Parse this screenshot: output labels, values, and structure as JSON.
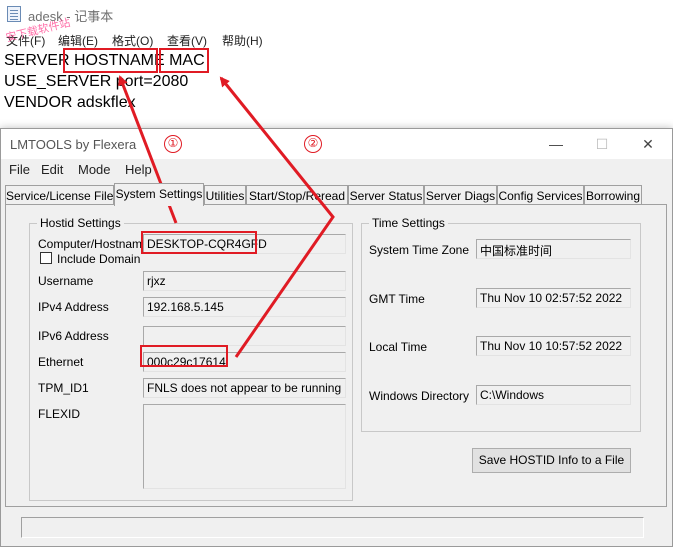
{
  "notepad": {
    "title": "adesk - 记事本",
    "watermark": "安下载软件站",
    "menu": [
      "文件(F)",
      "编辑(E)",
      "格式(O)",
      "查看(V)",
      "帮助(H)"
    ],
    "lines": [
      "SERVER HOSTNAME MAC",
      "USE_SERVER port=2080",
      "VENDOR adskflex"
    ]
  },
  "lmtools": {
    "title": "LMTOOLS by Flexera",
    "controls": {
      "minimize": "—",
      "maximize": "☐",
      "close": "✕"
    },
    "menu": [
      "File",
      "Edit",
      "Mode",
      "Help"
    ],
    "tabs": [
      "Service/License File",
      "System Settings",
      "Utilities",
      "Start/Stop/Reread",
      "Server Status",
      "Server Diags",
      "Config Services",
      "Borrowing"
    ],
    "active_tab": "System Settings",
    "hostid": {
      "group_label": "Hostid Settings",
      "computer_hostname_label": "Computer/Hostname",
      "computer_hostname": "DESKTOP-CQR4GFD",
      "include_domain_label": "Include Domain",
      "username_label": "Username",
      "username": "rjxz",
      "ipv4_label": "IPv4 Address",
      "ipv4": "192.168.5.145",
      "ipv6_label": "IPv6 Address",
      "ipv6": "",
      "ethernet_label": "Ethernet",
      "ethernet": "000c29c17614",
      "tpm_label": "TPM_ID1",
      "tpm": "FNLS does not appear to be running",
      "flexid_label": "FLEXID"
    },
    "time": {
      "group_label": "Time Settings",
      "timezone_label": "System Time Zone",
      "timezone": "中国标准时间",
      "gmt_label": "GMT Time",
      "gmt": "Thu Nov 10 02:57:52 2022",
      "local_label": "Local Time",
      "local": "Thu Nov 10 10:57:52 2022",
      "windir_label": "Windows Directory",
      "windir": "C:\\Windows"
    },
    "save_button": "Save HOSTID Info to a File"
  },
  "annotations": {
    "marker_1": "①",
    "marker_2": "②",
    "color": "#e01b24"
  }
}
